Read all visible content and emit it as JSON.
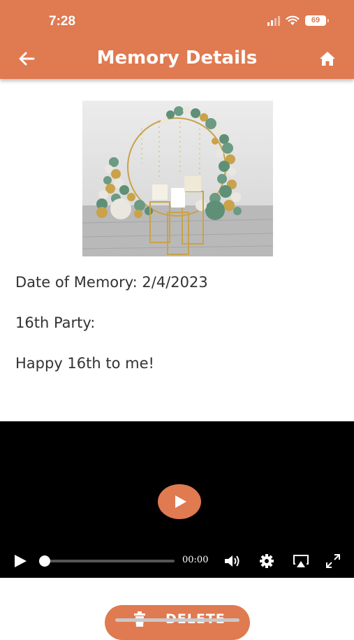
{
  "status_bar": {
    "time": "7:28",
    "battery": "69"
  },
  "header": {
    "title": "Memory Details",
    "back_icon": "arrow-left-icon",
    "home_icon": "home-icon"
  },
  "memory": {
    "date_line": "Date of Memory: 2/4/2023",
    "name_line": "16th Party:",
    "description": "Happy 16th to me!"
  },
  "video": {
    "time": "00:00",
    "progress": 0
  },
  "actions": {
    "delete_label": "DELETE"
  },
  "colors": {
    "accent": "#e07a51",
    "video_bg": "#000000",
    "text": "#333333"
  }
}
